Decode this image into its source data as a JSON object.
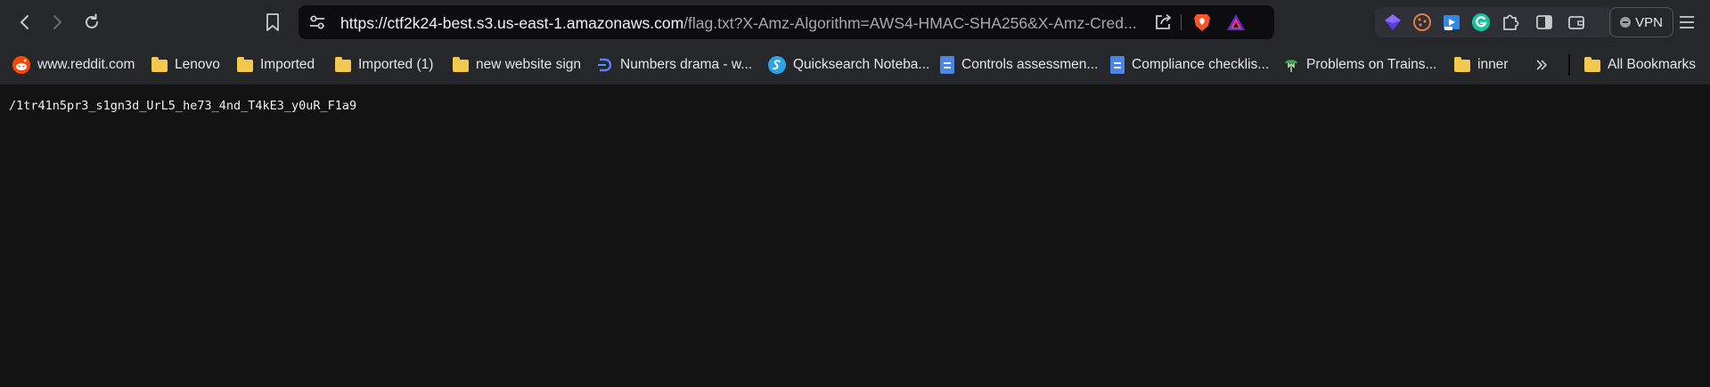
{
  "url": {
    "host": "https://ctf2k24-best.s3.us-east-1.amazonaws.com",
    "rest": "/flag.txt?X-Amz-Algorithm=AWS4-HMAC-SHA256&X-Amz-Cred..."
  },
  "vpn_label": "VPN",
  "bookmarks": [
    {
      "label": "www.reddit.com",
      "icon": "reddit-icon"
    },
    {
      "label": "Lenovo",
      "icon": "folder-icon"
    },
    {
      "label": "Imported",
      "icon": "folder-icon"
    },
    {
      "label": "Imported (1)",
      "icon": "folder-icon"
    },
    {
      "label": "new website sign",
      "icon": "folder-icon"
    },
    {
      "label": "Numbers drama - w...",
      "icon": "site-icon"
    },
    {
      "label": "Quicksearch Noteba...",
      "icon": "quicksearch-icon"
    },
    {
      "label": "Controls assessmen...",
      "icon": "docs-icon"
    },
    {
      "label": "Compliance checklis...",
      "icon": "docs-icon"
    },
    {
      "label": "Problems on Trains...",
      "icon": "site-icon"
    },
    {
      "label": "inner",
      "icon": "folder-icon"
    },
    {
      "label": "All Bookmarks",
      "icon": "folder-icon"
    }
  ],
  "page_text": "/1tr41n5pr3_s1gn3d_UrL5_he73_4nd_T4kE3_y0uR_F1a9",
  "colors": {
    "toolbar": "#26272b",
    "content_bg": "#121212",
    "folder": "#f2c94c",
    "brave": "#fb542b",
    "docs": "#4a86e8"
  }
}
